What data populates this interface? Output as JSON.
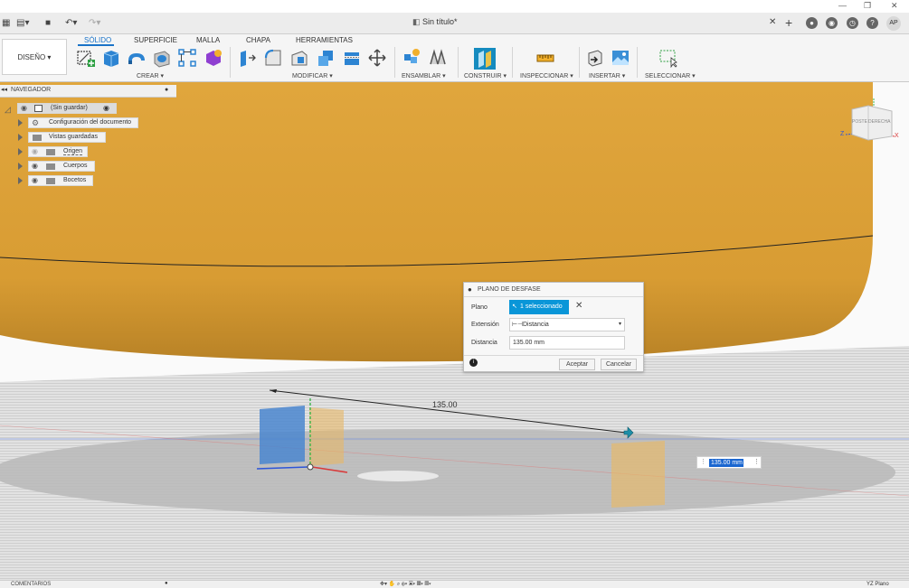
{
  "window": {
    "title": "Sin título*",
    "user_initials": "AP"
  },
  "workspace": {
    "label": "DISEÑO ▾",
    "tabs": [
      "SÓLIDO",
      "SUPERFICIE",
      "MALLA",
      "CHAPA",
      "HERRAMIENTAS"
    ],
    "active_tab": "SÓLIDO"
  },
  "toolbar": {
    "groups": [
      "CREAR ▾",
      "MODIFICAR ▾",
      "ENSAMBLAR ▾",
      "CONSTRUIR ▾",
      "INSPECCIONAR ▾",
      "INSERTAR ▾",
      "SELECCIONAR ▾"
    ]
  },
  "navigator": {
    "title": "NAVEGADOR",
    "items": [
      {
        "label": "(Sin guardar)"
      },
      {
        "label": "Configuración del documento"
      },
      {
        "label": "Vistas guardadas"
      },
      {
        "label": "Origen"
      },
      {
        "label": "Cuerpos"
      },
      {
        "label": "Bocetos"
      }
    ]
  },
  "dialog": {
    "title": "PLANO DE DESFASE",
    "plane_label": "Plano",
    "plane_value": "1 seleccionado",
    "extent_label": "Extensión",
    "extent_value": "Distancia",
    "distance_label": "Distancia",
    "distance_value": "135.00 mm",
    "ok_label": "Aceptar",
    "cancel_label": "Cancelar"
  },
  "viewport": {
    "dimension_text": "135.00",
    "dimension_input": "135.00 mm",
    "viewcube_face": "DERECHA",
    "viewcube_face_side": "POSTE",
    "axis_z": "Z",
    "axis_x": "X"
  },
  "statusbar": {
    "comments": "COMENTARIOS",
    "plane": "YZ Plano"
  },
  "colors": {
    "body": "#dca23a",
    "accent": "#1a73c8",
    "selected_button": "#0a96d8"
  }
}
